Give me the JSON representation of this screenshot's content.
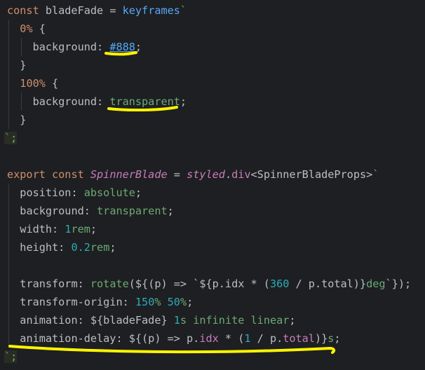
{
  "editor": {
    "line1": {
      "kw": "const",
      "name": " bladeFade ",
      "eq": "=",
      "sp": " ",
      "fn": "keyframes",
      "tick": "`"
    },
    "line2": {
      "indent": "  ",
      "sel": "0%",
      "brace": " {"
    },
    "line3": {
      "indent": "    ",
      "prop": "background",
      "colon": ": ",
      "value": "#888",
      "semi": ";"
    },
    "line4": {
      "indent": "  ",
      "brace": "}"
    },
    "line5": {
      "indent": "  ",
      "sel": "100%",
      "brace": " {"
    },
    "line6": {
      "indent": "    ",
      "prop": "background",
      "colon": ": ",
      "value": "transparent",
      "semi": ";"
    },
    "line7": {
      "indent": "  ",
      "brace": "}"
    },
    "line8": {
      "text": "`;"
    },
    "line10": {
      "kw1": "export",
      "kw2": " const ",
      "name": "SpinnerBlade",
      "eq": " = ",
      "styled": "styled",
      "dot": ".",
      "div": "div",
      "generic": "<SpinnerBladeProps>",
      "tick": "`"
    },
    "line11": {
      "indent": "  ",
      "prop": "position",
      "colon": ": ",
      "value": "absolute",
      "semi": ";"
    },
    "line12": {
      "indent": "  ",
      "prop": "background",
      "colon": ": ",
      "value": "transparent",
      "semi": ";"
    },
    "line13": {
      "indent": "  ",
      "prop": "width",
      "colon": ": ",
      "num": "1",
      "unit": "rem",
      "semi": ";"
    },
    "line14": {
      "indent": "  ",
      "prop": "height",
      "colon": ": ",
      "num": "0.2",
      "unit": "rem",
      "semi": ";"
    },
    "line16": {
      "indent": "  ",
      "prop": "transform",
      "colon": ": ",
      "fn": "rotate",
      "a": "(${(p) => `${p.idx * (",
      "n": "360",
      "b": " / p.total)}",
      "unit": "deg",
      "c": "`});"
    },
    "line17": {
      "indent": "  ",
      "prop": "transform-origin",
      "colon": ": ",
      "n1": "150",
      "p1": "%",
      "sp": " ",
      "n2": "50",
      "p2": "%",
      "semi": ";"
    },
    "line18": {
      "indent": "  ",
      "prop": "animation",
      "colon": ": ",
      "interp": "${bladeFade}",
      "sp": " ",
      "num": "1",
      "unit": "s",
      "rest": " infinite linear",
      "semi": ";"
    },
    "line19": {
      "indent": "  ",
      "prop": "animation-delay",
      "colon": ": ",
      "a": "${(p) => p.",
      "m1": "idx",
      "b": " * (",
      "n": "1",
      "c": " / p.",
      "m2": "total",
      "d": ")}",
      "unit": "s",
      "semi": ";"
    },
    "line20": {
      "text": "`;"
    }
  }
}
